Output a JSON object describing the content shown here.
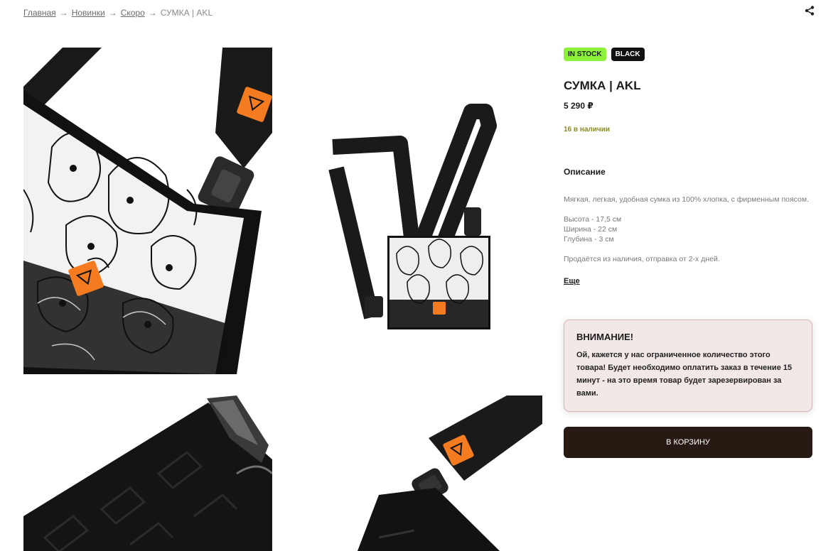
{
  "breadcrumb": {
    "items": [
      "Главная",
      "Новинки",
      "Скоро"
    ],
    "separator": "→",
    "current": "СУМКА | AKL"
  },
  "share": {
    "icon": "share-icon"
  },
  "gallery": {
    "photos": [
      {
        "name": "bag-front-closeup"
      },
      {
        "name": "bag-full-view"
      },
      {
        "name": "strap-detail"
      },
      {
        "name": "bag-back-detail"
      }
    ]
  },
  "product": {
    "badges": {
      "stock": "IN STOCK",
      "color": "BLACK"
    },
    "title": "СУМКА | AKL",
    "price": "5 290 ₽",
    "availability": "16 в наличии",
    "description_heading": "Описание",
    "description": {
      "line1": "Мягкая, легкая, удобная сумка из 100% хлопка, с фирменным поясом.",
      "height": "Высота - 17,5 см",
      "width": "Ширина - 22 см",
      "depth": "Глубина - 3 см",
      "shipping": "Продаётся из наличия, отправка от 2-х дней."
    },
    "more_label": "Еще"
  },
  "alert": {
    "title": "ВНИМАНИЕ!",
    "text": "Ой, кажется у нас ограниченное количество этого товара! Будет необходимо оплатить заказ в течение 15 минут - на это время товар будет зарезервирован за вами."
  },
  "cart_button": {
    "label": "В КОРЗИНУ"
  },
  "colors": {
    "stock_badge": "#8df13a",
    "availability": "#8a8a2a",
    "button": "#261a12",
    "alert_bg": "#f3e8e8",
    "logo_orange": "#f47b20"
  }
}
